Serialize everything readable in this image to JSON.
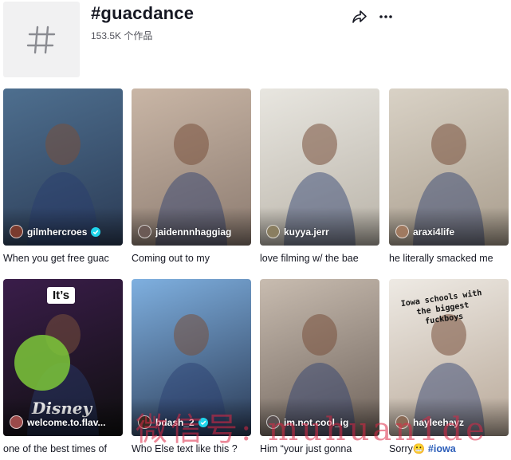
{
  "hashtag": {
    "title": "#guacdance",
    "count": "153.5K 个作品"
  },
  "videos": [
    {
      "author": "gilmhercroes",
      "verified": true,
      "caption": "When you get free guac",
      "hashtag": "",
      "avatar_color": "#7a3b2e",
      "bg": [
        "#4e6f8f",
        "#2b3b55"
      ]
    },
    {
      "author": "jaidennnhaggiag",
      "verified": false,
      "caption": "Coming out to my",
      "hashtag": "",
      "avatar_color": "#6b5a55",
      "bg": [
        "#c9b6a6",
        "#8c7b70"
      ]
    },
    {
      "author": "kuyya.jerr",
      "verified": false,
      "caption": "love filming w/ the bae",
      "hashtag": "",
      "avatar_color": "#8a7e60",
      "bg": [
        "#e8e6e0",
        "#b9b3a8"
      ]
    },
    {
      "author": "araxi4life",
      "verified": false,
      "caption": "he literally smacked me",
      "hashtag": "",
      "avatar_color": "#a07a60",
      "bg": [
        "#d9d2c6",
        "#a89c8c"
      ]
    },
    {
      "author": "welcome.to.flav...",
      "verified": false,
      "caption": "one of the best times of",
      "hashtag": "",
      "avatar_color": "#9b4a4a",
      "bg": [
        "#3a1d4a",
        "#0f0f0f"
      ]
    },
    {
      "author": "bdash_2",
      "verified": true,
      "caption": "Who Else text like this ?",
      "hashtag": "",
      "avatar_color": "#3a2a22",
      "bg": [
        "#7fb0e0",
        "#2a3a55"
      ]
    },
    {
      "author": "im.not.cool_ig",
      "verified": false,
      "caption": "Him “your just gonna",
      "hashtag": "",
      "avatar_color": "#5a5050",
      "bg": [
        "#c8bcb0",
        "#6e625a"
      ]
    },
    {
      "author": "hayleehayz",
      "verified": false,
      "caption": "Sorry😬 ",
      "hashtag": "#iowa",
      "avatar_color": "#8a6a55",
      "bg": [
        "#eeeae4",
        "#b8a898"
      ]
    }
  ],
  "overlays": {
    "its_text": "It’s",
    "iowa_text": "Iowa schools with the biggest fuckboys",
    "disney_text": "Disney"
  },
  "watermark": "微信号: muhuan1de",
  "icons": {
    "share": "share-icon",
    "more": "more-icon",
    "hashtag": "hashtag-icon",
    "verified": "verified-badge-icon"
  },
  "colors": {
    "verified": "#20d5ec",
    "hashtag_link": "#2b5db9",
    "text": "#161823"
  }
}
